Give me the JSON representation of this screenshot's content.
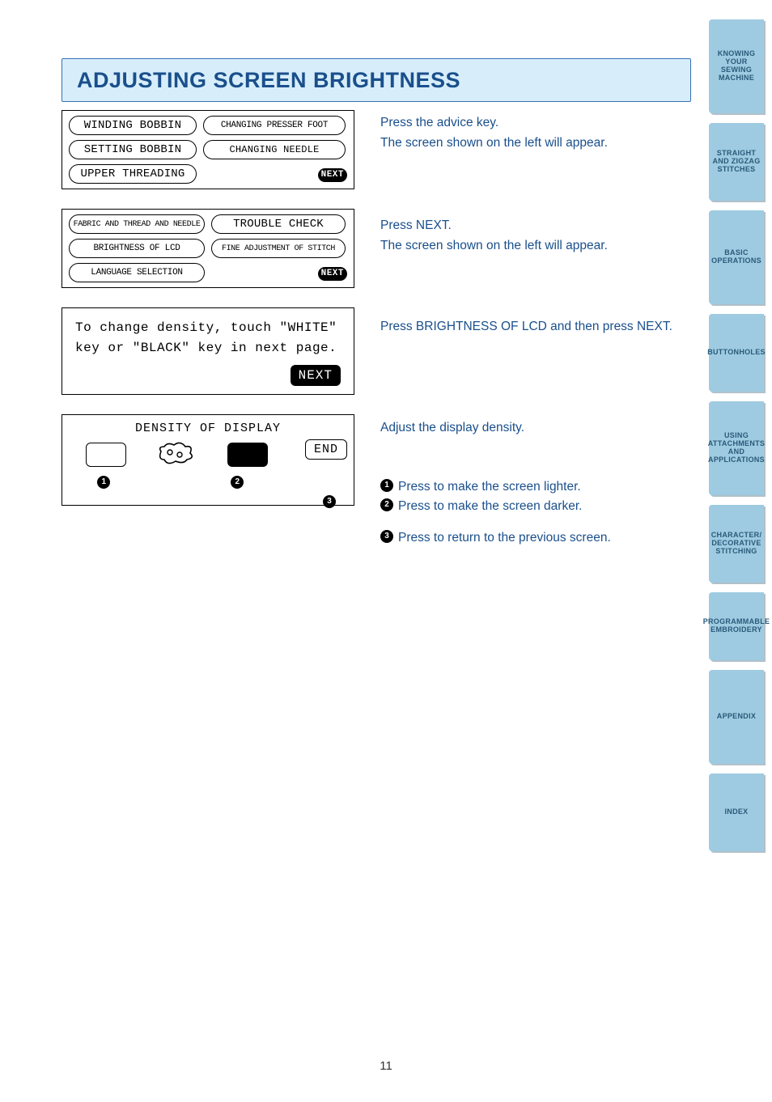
{
  "title": "ADJUSTING SCREEN BRIGHTNESS",
  "panel1": {
    "btn_winding": "WINDING BOBBIN",
    "btn_presser": "CHANGING PRESSER FOOT",
    "btn_setting": "SETTING BOBBIN",
    "btn_needle": "CHANGING NEEDLE",
    "btn_upper": "UPPER THREADING",
    "next": "NEXT"
  },
  "panel2": {
    "btn_fabric": "FABRIC AND THREAD AND NEEDLE",
    "btn_trouble": "TROUBLE CHECK",
    "btn_brightness": "BRIGHTNESS OF LCD",
    "btn_fine": "FINE ADJUSTMENT OF STITCH",
    "btn_lang": "LANGUAGE SELECTION",
    "next": "NEXT"
  },
  "panel3": {
    "line1": "To change density, touch \"WHITE\"",
    "line2": "key or \"BLACK\" key in next page.",
    "next": "NEXT"
  },
  "panel4": {
    "title": "DENSITY OF DISPLAY",
    "end": "END",
    "b1": "1",
    "b2": "2",
    "b3": "3"
  },
  "instr": {
    "s1a": "Press the advice key.",
    "s1b": "The screen shown on the left will appear.",
    "s2a": "Press NEXT.",
    "s2b": "The screen shown on the left will appear.",
    "s3a": "Press BRIGHTNESS OF LCD and then press NEXT.",
    "s4a": "Adjust the display density.",
    "l1a": "1",
    "l1b": "Press to make the screen lighter.",
    "l2a": "2",
    "l2b": "Press to make the screen darker.",
    "l3a": "3",
    "l3b": "Press to return to the previous screen."
  },
  "tabs": {
    "t1": "KNOWING YOUR SEWING MACHINE",
    "t2": "STRAIGHT AND ZIGZAG STITCHES",
    "t3": "BASIC OPERATIONS",
    "t4": "BUTTONHOLES",
    "t5": "USING ATTACHMENTS AND APPLICATIONS",
    "t6": "CHARACTER/ DECORATIVE STITCHING",
    "t7": "PROGRAMMABLE EMBROIDERY",
    "t8": "APPENDIX",
    "t9": "INDEX"
  },
  "page": "11"
}
